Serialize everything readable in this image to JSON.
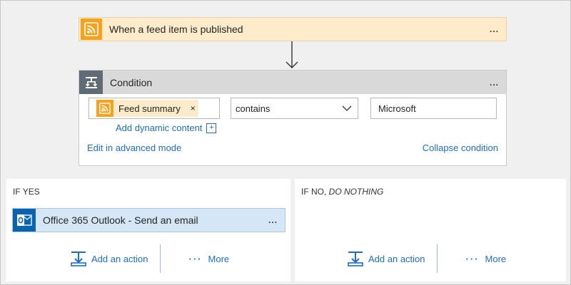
{
  "trigger": {
    "title": "When a feed item is published",
    "icon": "rss-icon",
    "menu": "..."
  },
  "condition": {
    "title": "Condition",
    "icon": "condition-icon",
    "menu": "...",
    "left_operand": {
      "token_label": "Feed summary",
      "token_remove": "×",
      "token_icon": "rss-icon"
    },
    "operator": "contains",
    "right_value": "Microsoft",
    "add_dynamic_content": "Add dynamic content",
    "edit_advanced": "Edit in advanced mode",
    "collapse": "Collapse condition"
  },
  "if_yes": {
    "label": "IF YES",
    "action": {
      "title": "Office 365 Outlook - Send an email",
      "icon": "outlook-icon",
      "menu": "..."
    },
    "add_action": "Add an action",
    "more": "More",
    "more_dots": "···"
  },
  "if_no": {
    "label_prefix": "IF NO, ",
    "label_emphasis": "DO NOTHING",
    "add_action": "Add an action",
    "more": "More",
    "more_dots": "···"
  },
  "colors": {
    "trigger_bg": "#fdebc9",
    "rss_orange": "#f7a21c",
    "condition_header": "#d9d9d9",
    "action_bg": "#d5e7f7",
    "outlook_blue": "#0a64ad",
    "link_blue": "#1c6fc2"
  }
}
